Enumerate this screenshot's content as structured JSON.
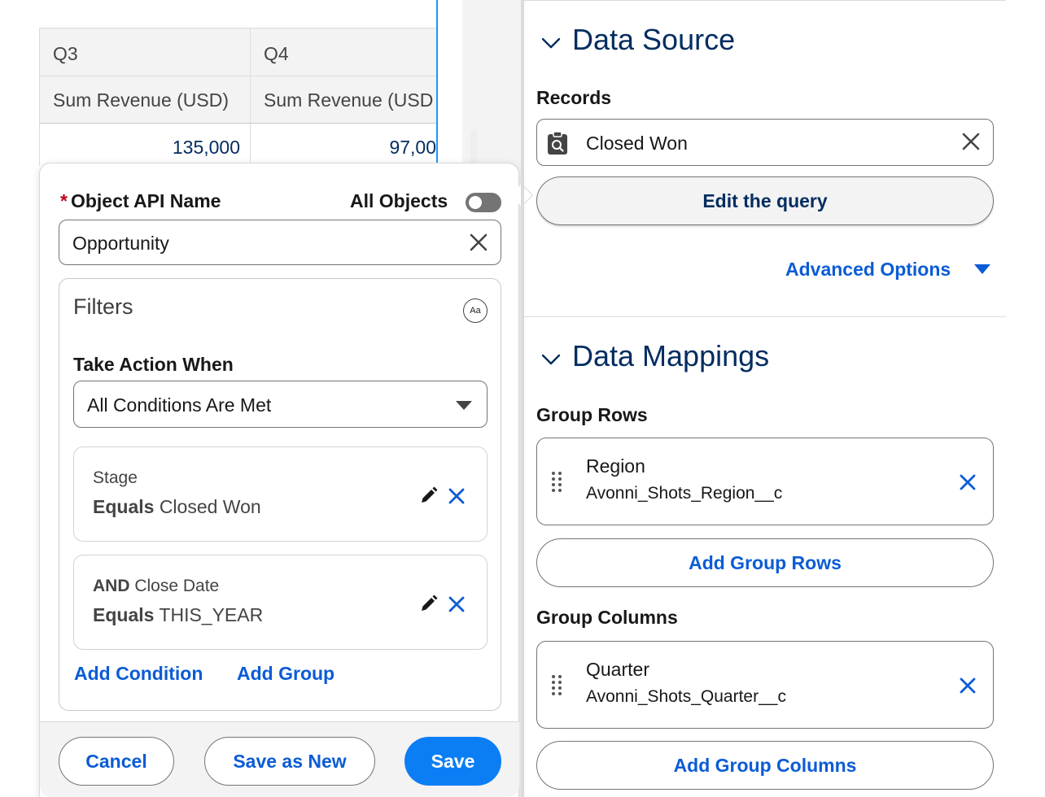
{
  "table": {
    "columns": [
      {
        "quarter": "Q3",
        "measure": "Sum Revenue (USD)",
        "value": "135,000"
      },
      {
        "quarter": "Q4",
        "measure": "Sum Revenue (USD",
        "value": "97,00"
      }
    ]
  },
  "popover": {
    "object_label": "Object API Name",
    "required_mark": "*",
    "all_objects_label": "All Objects",
    "all_objects_on": false,
    "object_value": "Opportunity",
    "filters": {
      "title": "Filters",
      "aa_icon_text": "Aa",
      "take_action_label": "Take Action When",
      "take_action_value": "All Conditions Are Met",
      "conditions": [
        {
          "prefix": "",
          "field": "Stage",
          "operator": "Equals",
          "value": "Closed Won"
        },
        {
          "prefix": "AND",
          "field": "Close Date",
          "operator": "Equals",
          "value": "THIS_YEAR"
        }
      ],
      "add_condition": "Add Condition",
      "add_group": "Add Group"
    },
    "footer": {
      "cancel": "Cancel",
      "save_as_new": "Save as New",
      "save": "Save"
    }
  },
  "panel": {
    "data_source": {
      "title": "Data Source",
      "records_label": "Records",
      "records_value": "Closed Won",
      "edit_query": "Edit the query",
      "advanced_options": "Advanced Options"
    },
    "data_mappings": {
      "title": "Data Mappings",
      "group_rows_label": "Group Rows",
      "group_rows": [
        {
          "label": "Region",
          "api_name": "Avonni_Shots_Region__c"
        }
      ],
      "add_group_rows": "Add Group Rows",
      "group_columns_label": "Group Columns",
      "group_columns": [
        {
          "label": "Quarter",
          "api_name": "Avonni_Shots_Quarter__c"
        }
      ],
      "add_group_columns": "Add Group Columns"
    }
  },
  "colors": {
    "link_blue": "#0b5cd5",
    "brand_blue": "#0b7ef5",
    "heading_navy": "#032d60",
    "required_red": "#ba0517",
    "selection_blue": "#1b96ff"
  }
}
